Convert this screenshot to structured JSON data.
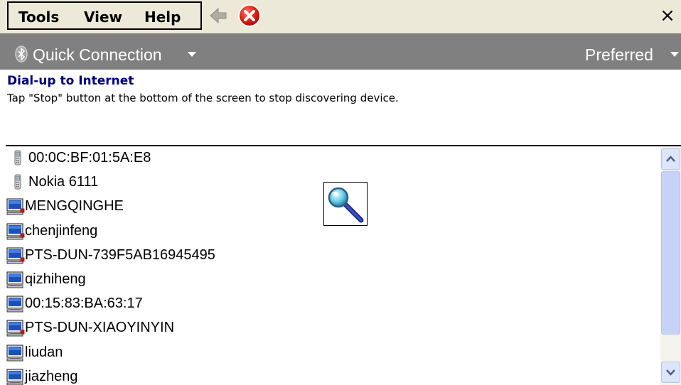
{
  "menubar": {
    "items": [
      {
        "label": "Tools"
      },
      {
        "label": "View"
      },
      {
        "label": "Help"
      }
    ],
    "icons": {
      "back": "back-arrow-icon",
      "stop": "stop-icon",
      "close": "close-icon"
    },
    "close_label": "×"
  },
  "command_bar": {
    "quick_connection_label": "Quick Connection",
    "preferred_label": "Preferred",
    "text_color": "#ffffff",
    "background": "#808080"
  },
  "header": {
    "title": "Dial-up to Internet",
    "instruction": "Tap \"Stop\" button at the bottom of the screen to stop discovering device.",
    "title_color": "#000080"
  },
  "devices": [
    {
      "label": "00:0C:BF:01:5A:E8",
      "icon": "phone-icon"
    },
    {
      "label": "Nokia 6111",
      "icon": "phone-icon"
    },
    {
      "label": "MENGQINGHE",
      "icon": "computer-red-icon"
    },
    {
      "label": "chenjinfeng",
      "icon": "computer-red-icon"
    },
    {
      "label": "PTS-DUN-739F5AB16945495",
      "icon": "computer-red-icon"
    },
    {
      "label": "qizhiheng",
      "icon": "computer-icon"
    },
    {
      "label": "00:15:83:BA:63:17",
      "icon": "computer-icon"
    },
    {
      "label": "PTS-DUN-XIAOYINYIN",
      "icon": "computer-red-icon"
    },
    {
      "label": "liudan",
      "icon": "computer-icon"
    },
    {
      "label": "jiazheng",
      "icon": "computer-icon"
    }
  ],
  "search_indicator": {
    "icon": "magnifier-icon"
  }
}
